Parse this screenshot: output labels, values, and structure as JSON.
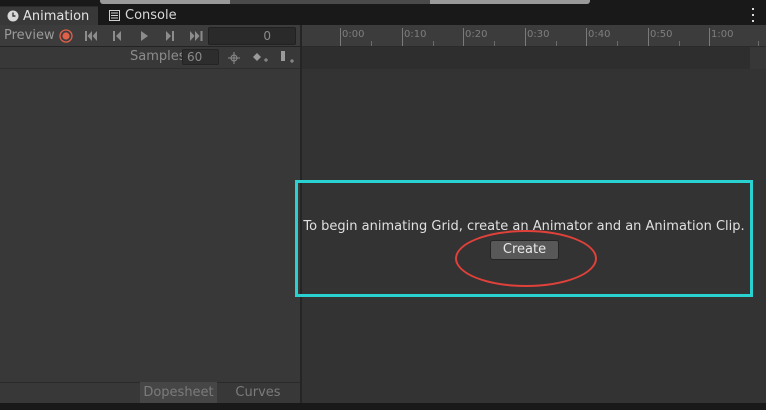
{
  "tabs": {
    "animation_label": "Animation",
    "console_label": "Console"
  },
  "toolbar": {
    "preview_label": "Preview",
    "frame_value": "0"
  },
  "samples": {
    "label": "Samples",
    "value": "60"
  },
  "timeline": {
    "ticks": [
      "0:00",
      "0:10",
      "0:20",
      "0:30",
      "0:40",
      "0:50",
      "1:00"
    ]
  },
  "bottom_tabs": {
    "dopesheet_label": "Dopesheet",
    "curves_label": "Curves"
  },
  "message": {
    "text": "To begin animating Grid, create an Animator and an Animation Clip.",
    "button_label": "Create"
  },
  "colors": {
    "highlight": "#2ad1d1",
    "annotation": "#e0413a",
    "record": "#e0604a"
  },
  "icons": [
    "clock-icon",
    "console-icon",
    "kebab-menu-icon",
    "record-icon",
    "first-key-icon",
    "prev-key-icon",
    "play-icon",
    "next-key-icon",
    "last-key-icon",
    "filter-icon",
    "add-keyframe-icon",
    "add-event-icon"
  ]
}
